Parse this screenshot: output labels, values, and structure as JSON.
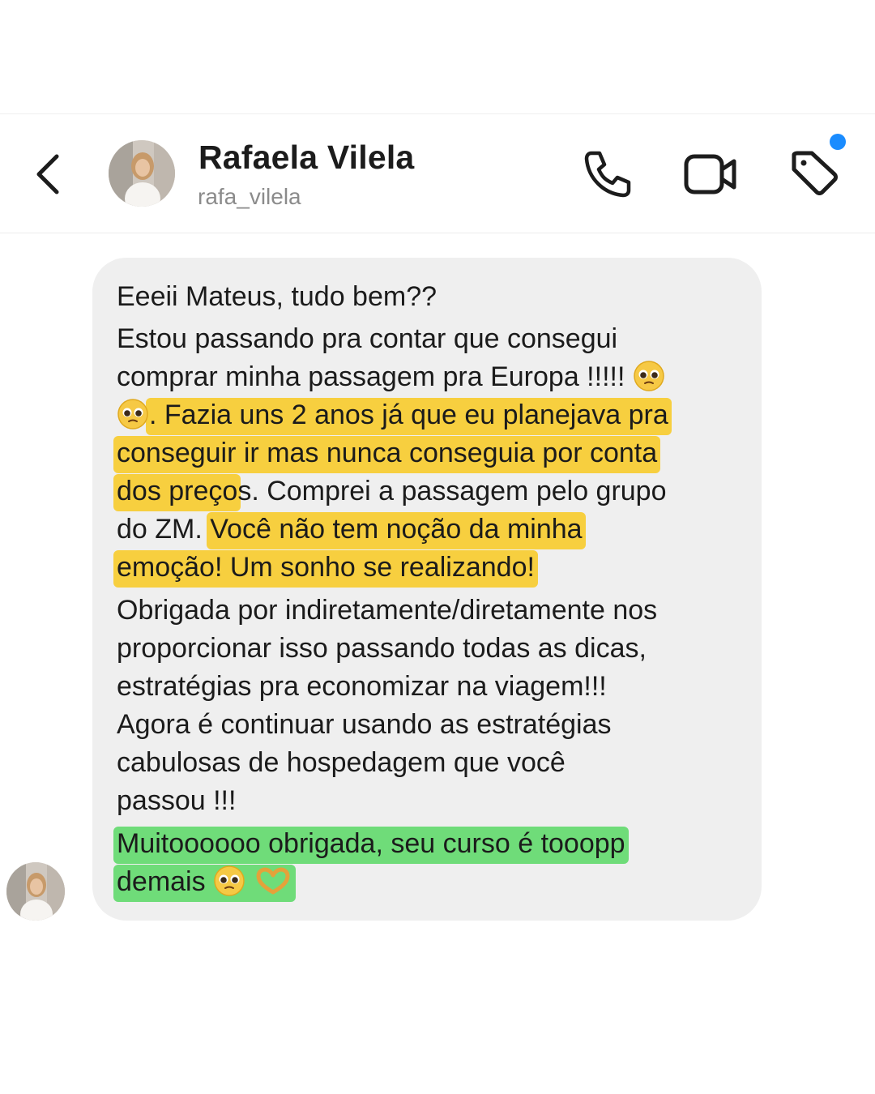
{
  "header": {
    "back_icon": "chevron-left-icon",
    "name": "Rafaela Vilela",
    "handle": "rafa_vilela",
    "actions": [
      "phone-icon",
      "video-camera-icon",
      "tag-icon"
    ],
    "notification_color": "#1a8cff"
  },
  "message": {
    "bubble_color": "#efefef",
    "highlight_yellow": "#f7cf3f",
    "highlight_green": "#6fdc79",
    "lines": {
      "l1": "Eeeii Mateus, tudo bem??",
      "l2": "Estou passando pra contar que consegui",
      "l3": "comprar minha passagem pra Europa !!!!!",
      "l4": ". Fazia uns 2 anos já que eu planejava pra",
      "l5": "conseguir ir mas nunca conseguia por conta",
      "l6a": "dos preço",
      "l6b": "s. Comprei a passagem pelo grupo",
      "l7a": "do ZM. ",
      "l7b": "Você não tem noção da minha",
      "l8": "emoção! Um sonho se realizando!",
      "l9": "Obrigada por indiretamente/diretamente nos",
      "l10": "proporcionar isso passando todas as dicas,",
      "l11": "estratégias pra economizar na viagem!!!",
      "l12": "Agora é continuar usando as estratégias",
      "l13": "cabulosas de hospedagem que você",
      "l14": "passou !!!",
      "l15": "Muitoooooo obrigada, seu curso é tooopp",
      "l16": "demais"
    },
    "emojis": [
      "pleading-face-icon",
      "pleading-face-icon",
      "pleading-face-icon",
      "heart-hands-icon"
    ]
  }
}
